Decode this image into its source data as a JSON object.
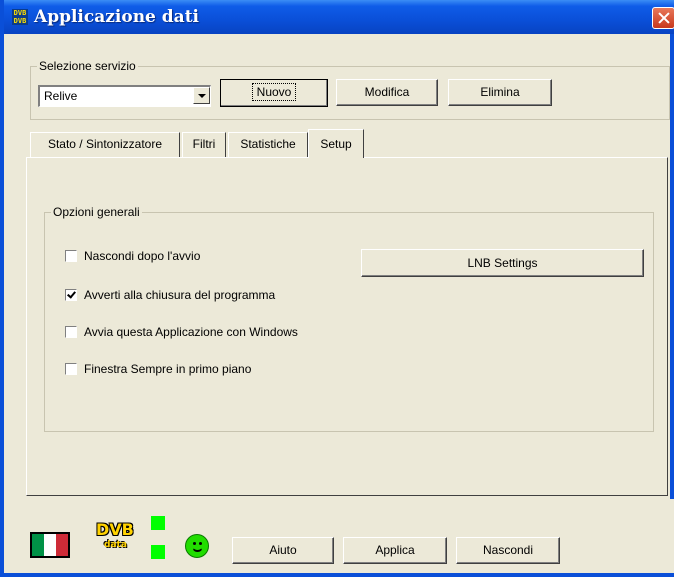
{
  "window": {
    "title": "Applicazione dati"
  },
  "service": {
    "group_label": "Selezione servizio",
    "selected": "Relive",
    "new_label": "Nuovo",
    "edit_label": "Modifica",
    "delete_label": "Elimina"
  },
  "tabs": [
    {
      "label": "Stato / Sintonizzatore"
    },
    {
      "label": "Filtri"
    },
    {
      "label": "Statistiche"
    },
    {
      "label": "Setup",
      "active": true
    }
  ],
  "setup": {
    "group_label": "Opzioni generali",
    "lnb_button": "LNB Settings",
    "options": [
      {
        "label": "Nascondi dopo l'avvio",
        "checked": false
      },
      {
        "label": "Avverti alla chiusura del programma",
        "checked": true
      },
      {
        "label": "Avvia questa Applicazione con Windows",
        "checked": false
      },
      {
        "label": "Finestra Sempre in primo piano",
        "checked": false
      }
    ]
  },
  "footer": {
    "logo_top": "DVB",
    "logo_bottom": "data",
    "help_label": "Aiuto",
    "apply_label": "Applica",
    "hide_label": "Nascondi",
    "flag_colors": [
      "#009246",
      "#ffffff",
      "#ce2b37"
    ],
    "status_led_color": "#00ff00"
  }
}
